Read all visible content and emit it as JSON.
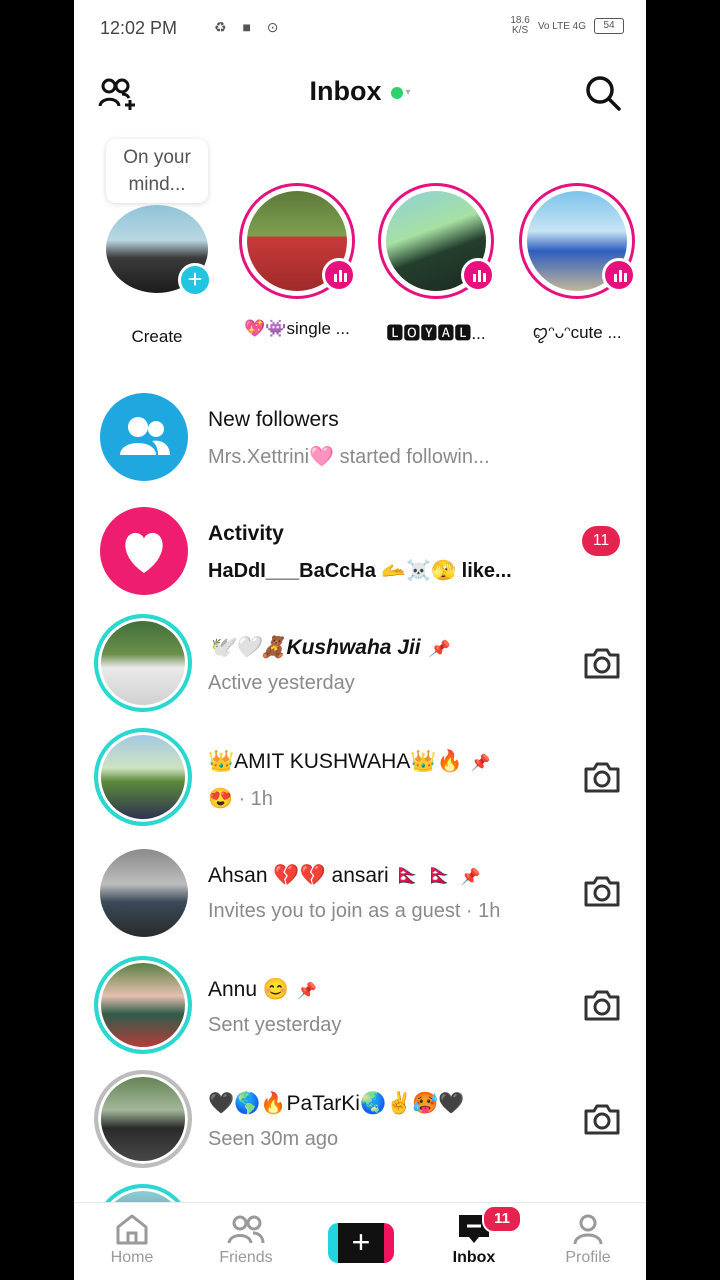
{
  "status_bar": {
    "time": "12:02 PM",
    "speed_top": "18.6",
    "speed_bottom": "K/S",
    "network": "Vo LTE 4G",
    "battery": "54"
  },
  "header": {
    "title": "Inbox"
  },
  "stories": {
    "prompt": "On your mind...",
    "create_label": "Create",
    "items": [
      {
        "label": "💖👾single ..."
      },
      {
        "label": "🅻🅾🆈🅰🅻..."
      },
      {
        "label": "ꨄ︎ᵔᴗᵔcute ..."
      }
    ]
  },
  "messages": [
    {
      "name": "New followers",
      "sub": "Mrs.Xettrini🩷 started followin..."
    },
    {
      "name": "Activity",
      "sub": "HaDdI___BaCcHa 🫴☠️🫣 like...",
      "badge": "11"
    },
    {
      "name": "🕊️🤍🧸Kushwaha Jii",
      "sub": "Active yesterday"
    },
    {
      "name": "👑AMIT KUSHWAHA👑🔥",
      "sub": "😍 · 1h"
    },
    {
      "name": "Ahsan 💔💔 ansari 🇳🇵 🇳🇵",
      "sub": "Invites you to join as a guest · 1h"
    },
    {
      "name": "Annu 😊",
      "sub": "Sent yesterday"
    },
    {
      "name": "🖤🌎🔥PaTarKi🌏✌️🥵🖤",
      "sub": "Seen 30m ago"
    }
  ],
  "tabs": {
    "home": "Home",
    "friends": "Friends",
    "inbox": "Inbox",
    "inbox_badge": "11",
    "profile": "Profile"
  },
  "colors": {
    "accent_pink": "#e6117f",
    "badge_red": "#e6234f",
    "teal": "#22c4df",
    "online": "#2ad36b"
  }
}
